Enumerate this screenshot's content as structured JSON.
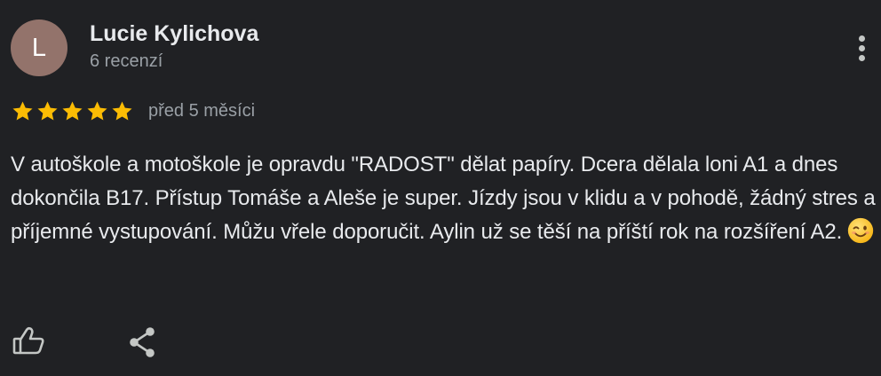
{
  "review": {
    "avatar_letter": "L",
    "author_name": "Lucie Kylichova",
    "review_count": "6 recenzí",
    "rating": 5,
    "date": "před 5 měsíci",
    "text": "V autoškole a motoškole je opravdu \"RADOST\" dělat papíry. Dcera dělala loni A1 a dnes dokončila B17. Přístup Tomáše a Aleše je super. Jízdy jsou v klidu a v pohodě, žádný stres a příjemné vystupování. Můžu vřele doporučit. Aylin už se těší na příští rok na rozšíření A2."
  },
  "icons": {
    "more": "more-vertical-icon",
    "star": "star-icon",
    "emoji": "winking-face-emoji",
    "like": "thumbs-up-icon",
    "share": "share-icon"
  },
  "colors": {
    "background": "#202124",
    "avatar_bg": "#93736b",
    "star": "#fbbc04",
    "text_primary": "#e8eaed",
    "text_secondary": "#9aa0a6"
  }
}
